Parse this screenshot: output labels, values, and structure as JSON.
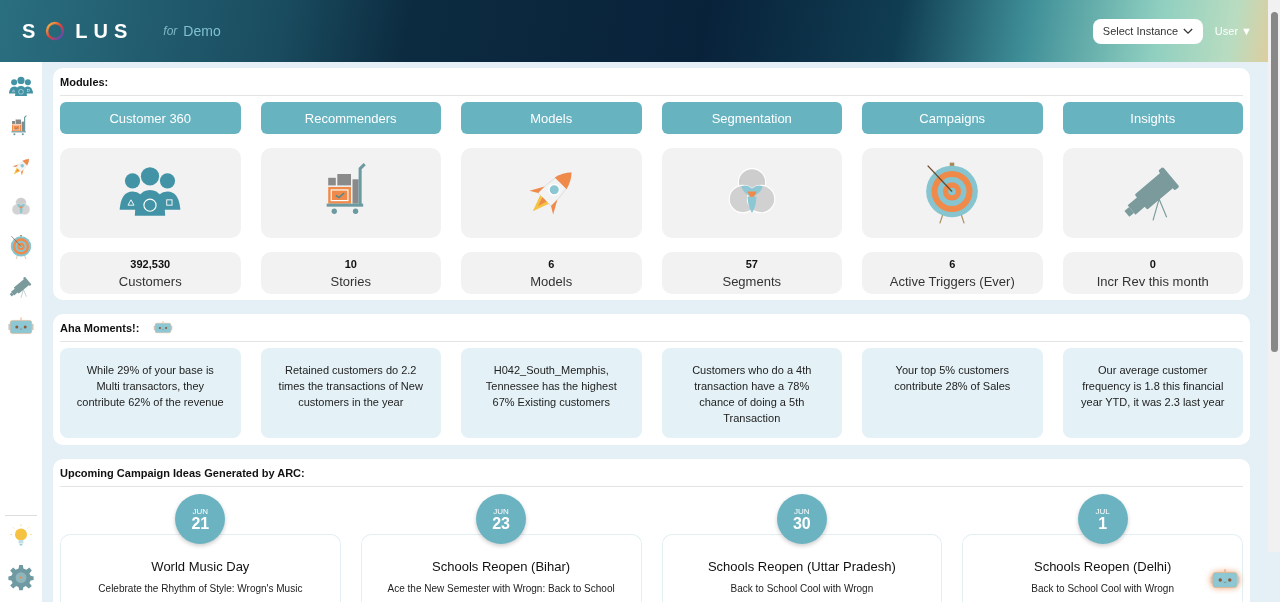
{
  "header": {
    "logo_start": "S",
    "logo_end": "LUS",
    "tagline_prefix": "for",
    "tagline": "Demo",
    "instance_select": {
      "placeholder": "Select Instance"
    },
    "user_menu": "User ▼"
  },
  "modules": {
    "title": "Modules:",
    "items": [
      {
        "label": "Customer 360",
        "kind": "people",
        "count": "392,530",
        "unit": "Customers"
      },
      {
        "label": "Recommenders",
        "kind": "cart",
        "count": "10",
        "unit": "Stories"
      },
      {
        "label": "Models",
        "kind": "rocket",
        "count": "6",
        "unit": "Models"
      },
      {
        "label": "Segmentation",
        "kind": "venn",
        "count": "57",
        "unit": "Segments"
      },
      {
        "label": "Campaigns",
        "kind": "target",
        "count": "6",
        "unit": "Active Triggers (Ever)"
      },
      {
        "label": "Insights",
        "kind": "telescope",
        "count": "0",
        "unit": "Incr Rev this month"
      }
    ]
  },
  "aha": {
    "title": "Aha Moments!:",
    "items": [
      "While 29% of your base is Multi transactors, they contribute 62% of the revenue",
      "Retained customers do 2.2 times the transactions of New customers in the year",
      "H042_South_Memphis, Tennessee has the highest 67% Existing customers",
      "Customers who do a 4th transaction have a 78% chance of doing a 5th Transaction",
      "Your top 5% customers contribute 28% of Sales",
      "Our average customer frequency is 1.8 this financial year YTD, it was 2.3 last year"
    ]
  },
  "campaigns": {
    "title": "Upcoming Campaign Ideas Generated by ARC:",
    "items": [
      {
        "month": "JUN",
        "day": "21",
        "title": "World Music Day",
        "description": "Celebrate the Rhythm of Style: Wrogn's Music"
      },
      {
        "month": "JUN",
        "day": "23",
        "title": "Schools Reopen (Bihar)",
        "description": "Ace the New Semester with Wrogn: Back to School"
      },
      {
        "month": "JUN",
        "day": "30",
        "title": "Schools Reopen (Uttar Pradesh)",
        "description": "Back to School Cool with Wrogn"
      },
      {
        "month": "JUL",
        "day": "1",
        "title": "Schools Reopen (Delhi)",
        "description": "Back to School Cool with Wrogn"
      }
    ]
  }
}
